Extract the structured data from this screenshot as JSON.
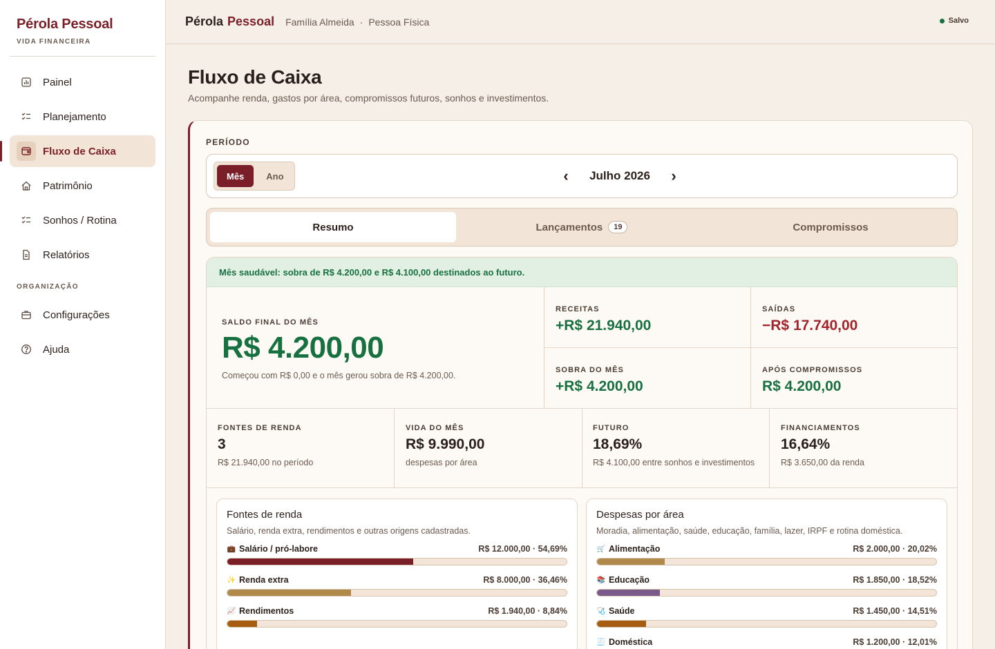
{
  "sidebar": {
    "brand_title": "Pérola Pessoal",
    "brand_sub": "VIDA FINANCEIRA",
    "items": [
      {
        "label": "Painel",
        "icon": "chart-icon"
      },
      {
        "label": "Planejamento",
        "icon": "checklist-icon"
      },
      {
        "label": "Fluxo de Caixa",
        "icon": "wallet-icon",
        "active": true
      },
      {
        "label": "Patrimônio",
        "icon": "home-icon"
      },
      {
        "label": "Sonhos / Rotina",
        "icon": "checklist-icon"
      },
      {
        "label": "Relatórios",
        "icon": "document-icon"
      }
    ],
    "section_label": "ORGANIZAÇÃO",
    "org_items": [
      {
        "label": "Configurações",
        "icon": "briefcase-icon"
      },
      {
        "label": "Ajuda",
        "icon": "help-icon"
      }
    ]
  },
  "topbar": {
    "brand_a": "Pérola",
    "brand_b": "Pessoal",
    "crumb_1": "Família Almeida",
    "crumb_sep": "·",
    "crumb_2": "Pessoa Física",
    "saved": "Salvo"
  },
  "page": {
    "title": "Fluxo de Caixa",
    "subtitle": "Acompanhe renda, gastos por área, compromissos futuros, sonhos e investimentos."
  },
  "period": {
    "label": "PERÍODO",
    "mode_month": "Mês",
    "mode_year": "Ano",
    "prev": "‹",
    "current": "Julho 2026",
    "next": "›"
  },
  "tabs": {
    "resumo": "Resumo",
    "lancamentos": "Lançamentos",
    "lancamentos_count": "19",
    "compromissos": "Compromissos"
  },
  "summary": {
    "banner": "Mês saudável: sobra de R$ 4.200,00 e R$ 4.100,00 destinados ao futuro.",
    "saldo_label": "SALDO FINAL DO MÊS",
    "saldo_value": "R$ 4.200,00",
    "saldo_note": "Começou com R$ 0,00 e o mês gerou sobra de R$ 4.200,00.",
    "receitas_label": "RECEITAS",
    "receitas_value": "+R$ 21.940,00",
    "saidas_label": "SAÍDAS",
    "saidas_value": "−R$ 17.740,00",
    "sobra_label": "SOBRA DO MÊS",
    "sobra_value": "+R$ 4.200,00",
    "apos_label": "APÓS COMPROMISSOS",
    "apos_value": "R$ 4.200,00",
    "fontes_label": "FONTES DE RENDA",
    "fontes_value": "3",
    "fontes_note": "R$ 21.940,00 no período",
    "vida_label": "VIDA DO MÊS",
    "vida_value": "R$ 9.990,00",
    "vida_note": "despesas por área",
    "futuro_label": "FUTURO",
    "futuro_value": "18,69%",
    "futuro_note": "R$ 4.100,00 entre sonhos e investimentos",
    "fin_label": "FINANCIAMENTOS",
    "fin_value": "16,64%",
    "fin_note": "R$ 3.650,00 da renda"
  },
  "income_panel": {
    "title": "Fontes de renda",
    "subtitle": "Salário, renda extra, rendimentos e outras origens cadastradas.",
    "items": [
      {
        "icon": "💼",
        "name": "Salário / pró-labore",
        "value": "R$ 12.000,00 · 54,69%",
        "pct": 54.69,
        "color": "#7a1f28"
      },
      {
        "icon": "✨",
        "name": "Renda extra",
        "value": "R$ 8.000,00 · 36,46%",
        "pct": 36.46,
        "color": "#b08a4a"
      },
      {
        "icon": "📈",
        "name": "Rendimentos",
        "value": "R$ 1.940,00 · 8,84%",
        "pct": 8.84,
        "color": "#a65d12"
      }
    ]
  },
  "expense_panel": {
    "title": "Despesas por área",
    "subtitle": "Moradia, alimentação, saúde, educação, família, lazer, IRPF e rotina doméstica.",
    "items": [
      {
        "icon": "🛒",
        "name": "Alimentação",
        "value": "R$ 2.000,00 · 20,02%",
        "pct": 20.02,
        "color": "#b08a4a"
      },
      {
        "icon": "📚",
        "name": "Educação",
        "value": "R$ 1.850,00 · 18,52%",
        "pct": 18.52,
        "color": "#7a5a8a"
      },
      {
        "icon": "🩺",
        "name": "Saúde",
        "value": "R$ 1.450,00 · 14,51%",
        "pct": 14.51,
        "color": "#a65d12"
      },
      {
        "icon": "🧾",
        "name": "Doméstica",
        "value": "R$ 1.200,00 · 12,01%",
        "pct": 12.01,
        "color": "#8a6a4a"
      }
    ]
  }
}
